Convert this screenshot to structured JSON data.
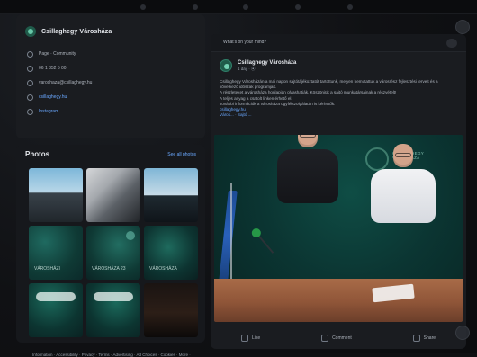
{
  "left": {
    "profile": {
      "name": "Csillaghegy Városháza",
      "info": [
        {
          "label": "Page · Community",
          "is_link": false,
          "icon": "info-icon"
        },
        {
          "label": "06 1 352 5 00",
          "is_link": false,
          "icon": "phone-icon"
        },
        {
          "label": "varoshaza@csillaghegy.hu",
          "is_link": false,
          "icon": "mail-icon"
        },
        {
          "label": "csillaghegy.hu",
          "is_link": true,
          "icon": "link-icon"
        },
        {
          "label": "Instagram",
          "is_link": true,
          "icon": "instagram-icon"
        }
      ]
    },
    "photos": {
      "title": "Photos",
      "see_all": "See all photos",
      "tiles": [
        {
          "title": ""
        },
        {
          "title": ""
        },
        {
          "title": ""
        },
        {
          "title": "Városházi"
        },
        {
          "title": "Városháza 23"
        },
        {
          "title": "Városháza"
        },
        {
          "title": ""
        },
        {
          "title": ""
        },
        {
          "title": ""
        }
      ]
    },
    "bottom_caption": "Information · Accessibility · Privacy · Terms · Advertising · Ad Choices · Cookies · More ·"
  },
  "post": {
    "topbar_text": "What's on your mind?",
    "author": "Csillaghegy Városháza",
    "time": "1 day · ⦿",
    "text": [
      "Csillaghegy Városházán a mai napon sajtótájékoztatót tartottunk, melyen bemutattuk a városrész fejlesztési terveit és a következő időszak programjait.",
      "A részleteket a városháza honlapján olvashatják. Köszönjük a sajtó munkatársainak a részvételt!",
      "A teljes anyag a csatolt linken érhető el.",
      "További információk a városháza ügyfélszolgálatán is kérhetők."
    ],
    "link_text": "csillaghegy.hu",
    "tag_text": "Város... · Sajtó ...",
    "image": {
      "wall_text": "CSILLAGHEGY\nVÁROSHÁZA"
    },
    "actions": [
      {
        "label": "Like",
        "icon": "like-icon"
      },
      {
        "label": "Comment",
        "icon": "comment-icon"
      },
      {
        "label": "Share",
        "icon": "share-icon"
      }
    ]
  },
  "colors": {
    "link": "#6aa8ff",
    "brand_green": "#1f5b4a"
  }
}
